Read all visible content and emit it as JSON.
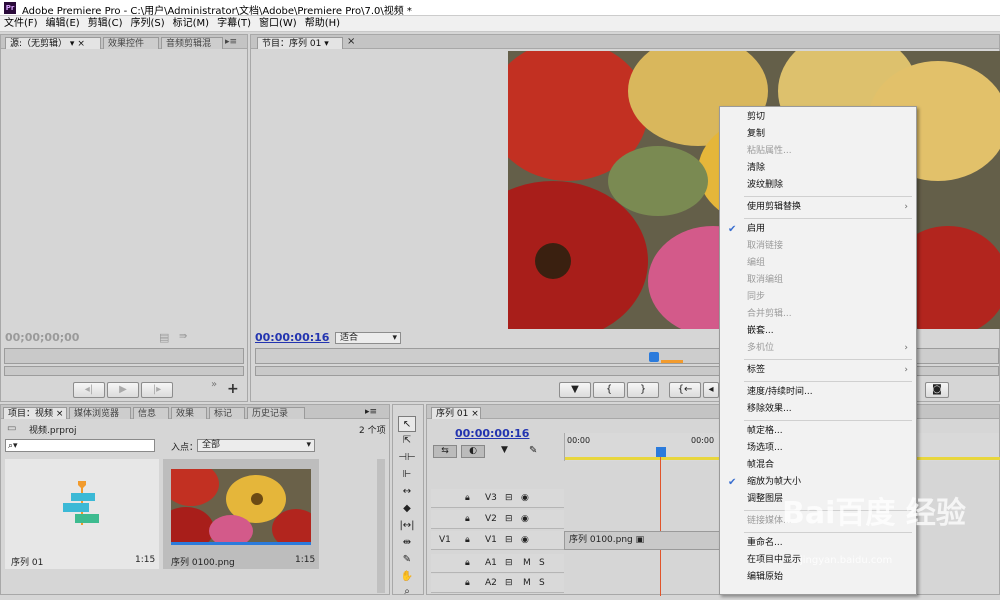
{
  "window": {
    "app_icon": "Pr",
    "title": "Adobe Premiere Pro - C:\\用户\\Administrator\\文档\\Adobe\\Premiere Pro\\7.0\\视频 *"
  },
  "menu": [
    "文件(F)",
    "编辑(E)",
    "剪辑(C)",
    "序列(S)",
    "标记(M)",
    "字幕(T)",
    "窗口(W)",
    "帮助(H)"
  ],
  "source_panel": {
    "tabs": [
      "源:（无剪辑）",
      "效果控件",
      "音频剪辑混"
    ],
    "timecode": "00;00;00;00"
  },
  "program_panel": {
    "tab": "节目：序列 01",
    "timecode": "00:00:00:16",
    "fit": "适合"
  },
  "project_panel": {
    "tabs": [
      "项目：视频",
      "媒体浏览器",
      "信息",
      "效果",
      "标记",
      "历史记录"
    ],
    "file": "视频.prproj",
    "count": "2 个项",
    "search_placeholder": "",
    "entry_label": "入点：",
    "entry_value": "全部",
    "items": [
      {
        "name": "序列 01",
        "duration": "1:15"
      },
      {
        "name": "序列 0100.png",
        "duration": "1:15"
      }
    ]
  },
  "timeline": {
    "tab": "序列 01",
    "timecode": "00:00:00:16",
    "ruler": [
      "00:00",
      "00:00"
    ],
    "tracks": [
      {
        "name": "V3",
        "type": "video"
      },
      {
        "name": "V2",
        "type": "video"
      },
      {
        "name": "V1",
        "type": "video",
        "source": "V1",
        "clip": "序列 0100.png"
      },
      {
        "name": "A1",
        "type": "audio"
      },
      {
        "name": "A2",
        "type": "audio"
      }
    ],
    "mute": "M",
    "solo": "S"
  },
  "context_menu": {
    "items": [
      {
        "label": "剪切",
        "enabled": true
      },
      {
        "label": "复制",
        "enabled": true
      },
      {
        "label": "粘贴属性...",
        "enabled": false
      },
      {
        "label": "清除",
        "enabled": true
      },
      {
        "label": "波纹删除",
        "enabled": true
      },
      {
        "sep": true
      },
      {
        "label": "使用剪辑替换",
        "enabled": true,
        "submenu": true
      },
      {
        "sep": true
      },
      {
        "label": "启用",
        "enabled": true,
        "checked": true
      },
      {
        "label": "取消链接",
        "enabled": false
      },
      {
        "label": "编组",
        "enabled": false
      },
      {
        "label": "取消编组",
        "enabled": false
      },
      {
        "label": "同步",
        "enabled": false
      },
      {
        "label": "合并剪辑...",
        "enabled": false
      },
      {
        "label": "嵌套...",
        "enabled": true
      },
      {
        "label": "多机位",
        "enabled": false,
        "submenu": true
      },
      {
        "sep": true
      },
      {
        "label": "标签",
        "enabled": true,
        "submenu": true
      },
      {
        "sep": true
      },
      {
        "label": "速度/持续时间...",
        "enabled": true
      },
      {
        "label": "移除效果...",
        "enabled": true
      },
      {
        "sep": true
      },
      {
        "label": "帧定格...",
        "enabled": true
      },
      {
        "label": "场选项...",
        "enabled": true
      },
      {
        "label": "帧混合",
        "enabled": true
      },
      {
        "label": "缩放为帧大小",
        "enabled": true,
        "checked": true
      },
      {
        "label": "调整图层",
        "enabled": true
      },
      {
        "sep": true
      },
      {
        "label": "链接媒体...",
        "enabled": false
      },
      {
        "sep": true
      },
      {
        "label": "重命名...",
        "enabled": true
      },
      {
        "label": "在项目中显示",
        "enabled": true
      },
      {
        "label": "编辑原始",
        "enabled": true
      }
    ]
  },
  "watermark": {
    "brand": "Bai百度",
    "text": "经验",
    "url": "jingyan.baidu.com"
  },
  "colors": {
    "timecode": "#2334b0",
    "playhead": "#2b7bdc",
    "clip_cyan": "#3bb9d6",
    "clip_green": "#3dbb8f",
    "marker_orange": "#f29b2d"
  }
}
